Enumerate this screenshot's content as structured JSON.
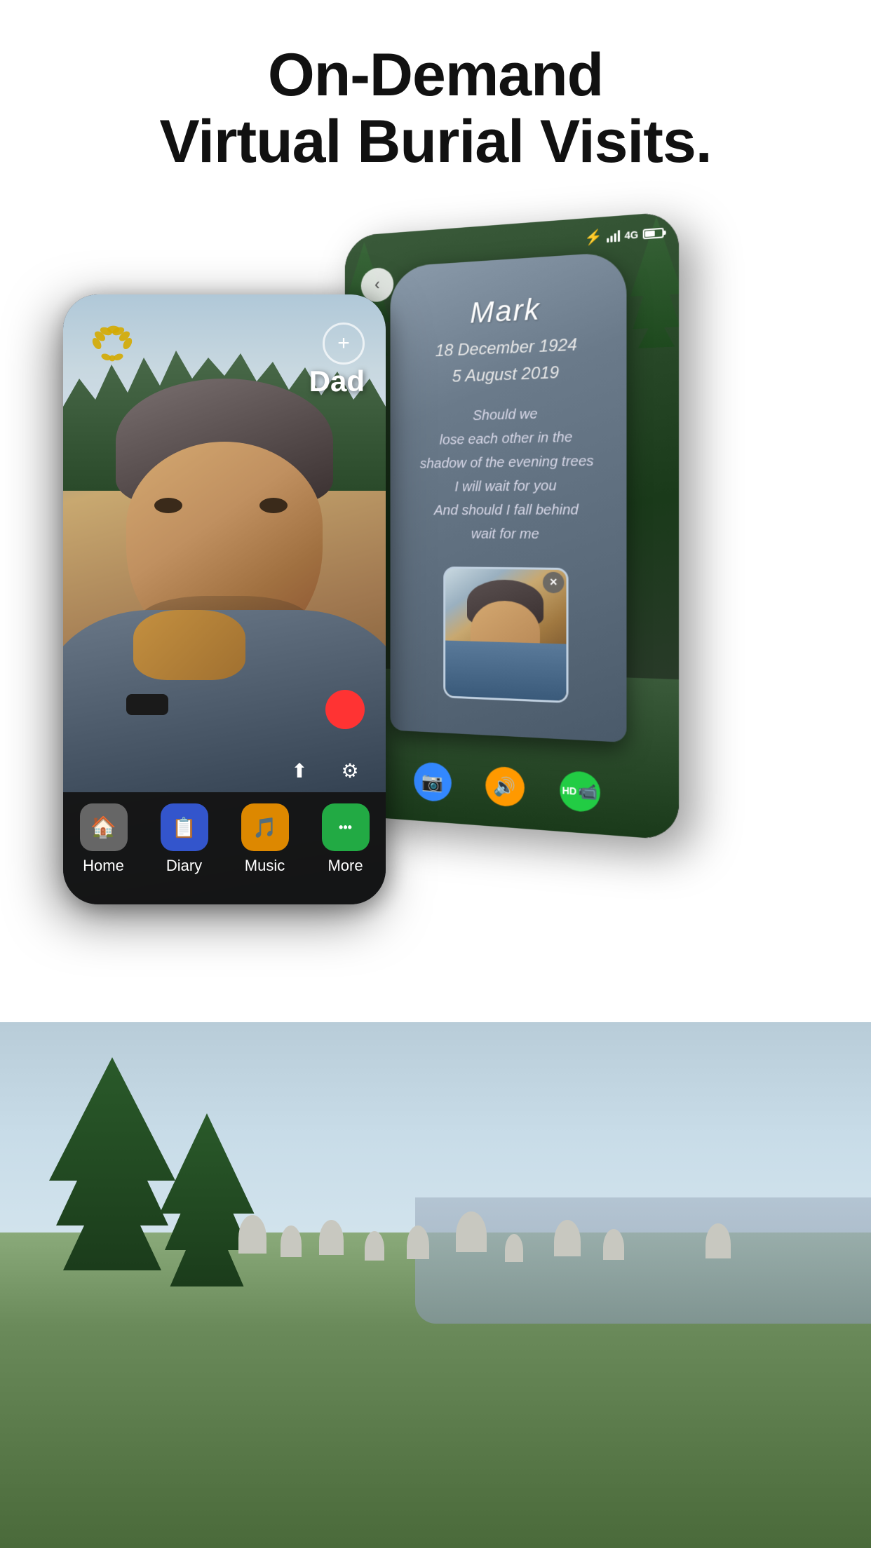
{
  "header": {
    "title_line1": "On-Demand",
    "title_line2": "Virtual Burial Visits."
  },
  "back_phone": {
    "status_bar": {
      "signal": "4G",
      "battery_level": "60"
    },
    "back_button": "‹",
    "gravestone": {
      "name": "Mark",
      "date_birth": "18 December 1924",
      "date_death": "5 August 2019",
      "inscription_line1": "Should we",
      "inscription_line2": "lose each other in the",
      "inscription_line3": "shadow of the evening trees",
      "inscription_line4": "I will wait for you",
      "inscription_line5": "And should I fall behind",
      "inscription_line6": "wait for me",
      "close_btn": "✕"
    },
    "toolbar": {
      "camera_icon": "📷",
      "mute_icon": "🔇",
      "hd_label": "HD"
    }
  },
  "front_phone": {
    "person_name": "Dad",
    "logo_alt": "wreath-logo",
    "plus_btn_label": "+",
    "tabs": [
      {
        "id": "home",
        "icon": "🏠",
        "label": "Home"
      },
      {
        "id": "diary",
        "icon": "📋",
        "label": "Diary"
      },
      {
        "id": "music",
        "icon": "🎵",
        "label": "Music"
      },
      {
        "id": "more",
        "icon": "●●●",
        "label": "More"
      }
    ],
    "toolbar_share_icon": "⬆",
    "toolbar_settings_icon": "⚙"
  }
}
